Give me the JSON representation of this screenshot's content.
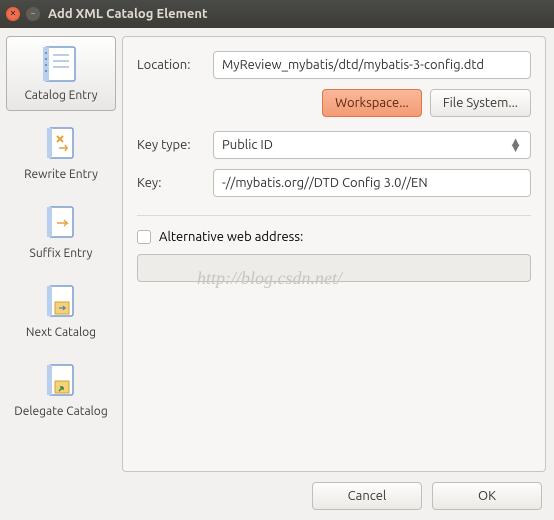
{
  "window": {
    "title": "Add XML Catalog Element"
  },
  "sidebar": {
    "items": [
      {
        "label": "Catalog Entry"
      },
      {
        "label": "Rewrite Entry"
      },
      {
        "label": "Suffix Entry"
      },
      {
        "label": "Next Catalog"
      },
      {
        "label": "Delegate Catalog"
      }
    ]
  },
  "form": {
    "location_label": "Location:",
    "location_value": "MyReview_mybatis/dtd/mybatis-3-config.dtd",
    "workspace_btn": "Workspace...",
    "filesystem_btn": "File System...",
    "keytype_label": "Key type:",
    "keytype_value": "Public ID",
    "key_label": "Key:",
    "key_value": "-//mybatis.org//DTD Config 3.0//EN",
    "alt_label": "Alternative web address:",
    "alt_value": ""
  },
  "footer": {
    "cancel": "Cancel",
    "ok": "OK"
  },
  "watermark": "http://blog.csdn.net/"
}
